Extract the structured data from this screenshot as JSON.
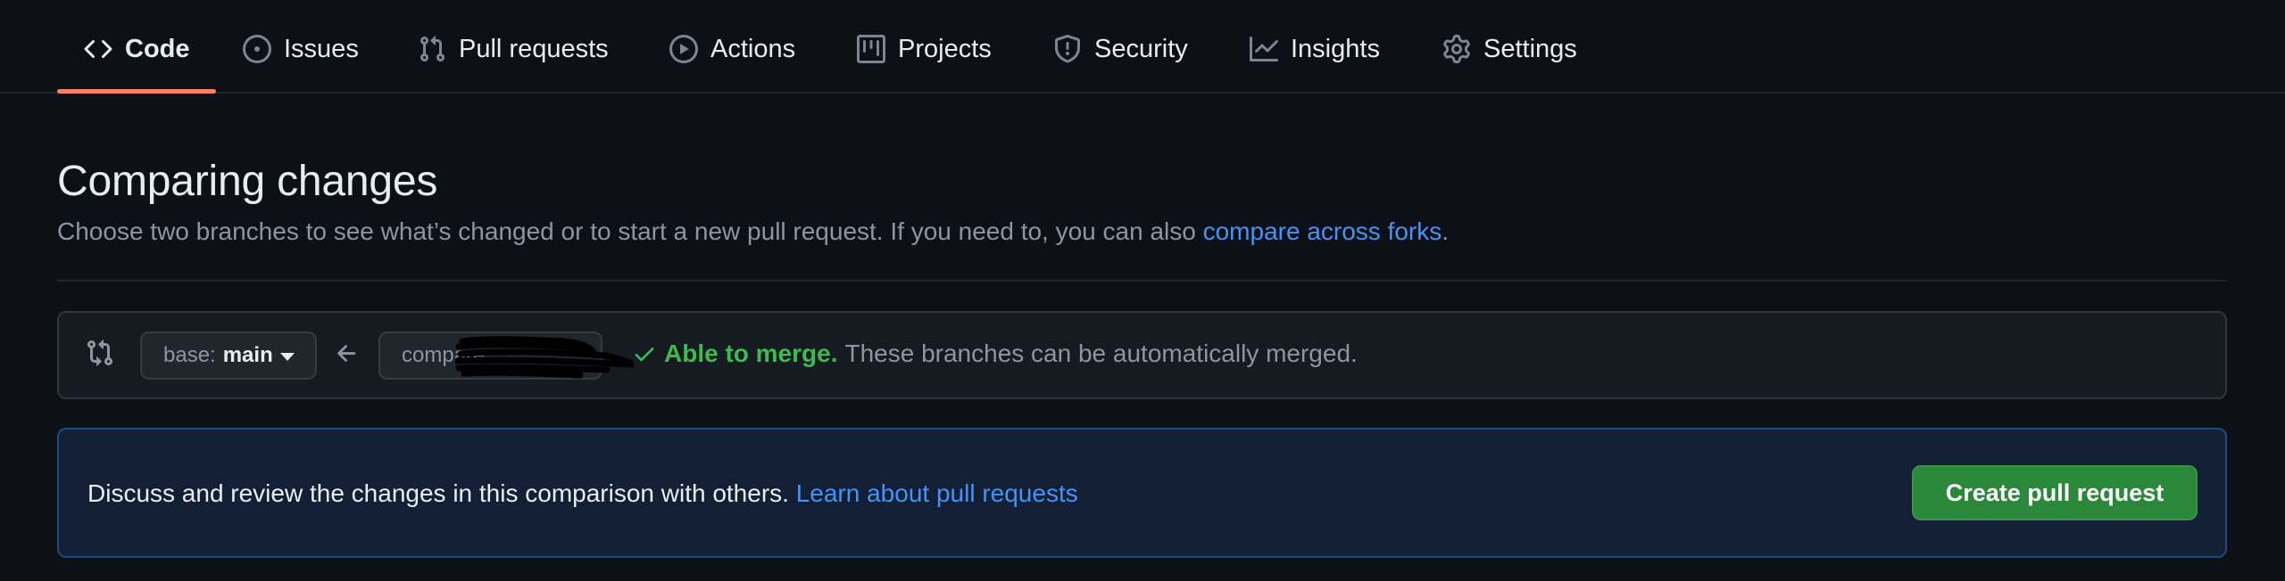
{
  "repo_nav": {
    "items": [
      {
        "label": "Code",
        "icon": "code-icon",
        "selected": true
      },
      {
        "label": "Issues",
        "icon": "issue-opened-icon",
        "selected": false
      },
      {
        "label": "Pull requests",
        "icon": "git-pull-request-icon",
        "selected": false
      },
      {
        "label": "Actions",
        "icon": "play-icon",
        "selected": false
      },
      {
        "label": "Projects",
        "icon": "table-icon",
        "selected": false
      },
      {
        "label": "Security",
        "icon": "shield-icon",
        "selected": false
      },
      {
        "label": "Insights",
        "icon": "graph-icon",
        "selected": false
      },
      {
        "label": "Settings",
        "icon": "gear-icon",
        "selected": false
      }
    ],
    "accent_color": "#f78166"
  },
  "header": {
    "title": "Comparing changes",
    "description": "Choose two branches to see what’s changed or to start a new pull request. If you need to, you can also ",
    "link_label": "compare across forks",
    "description_end": "."
  },
  "range_editor": {
    "base_prefix": "base:",
    "base_branch": "main",
    "compare_prefix": "compare:",
    "compare_branch_redacted": true,
    "status_label": "Able to merge.",
    "status_description": "These branches can be automatically merged.",
    "status_color": "#3fb950"
  },
  "flash": {
    "text": "Discuss and review the changes in this comparison with others. ",
    "link_label": "Learn about pull requests",
    "button_label": "Create pull request",
    "button_color": "#2b883b"
  }
}
